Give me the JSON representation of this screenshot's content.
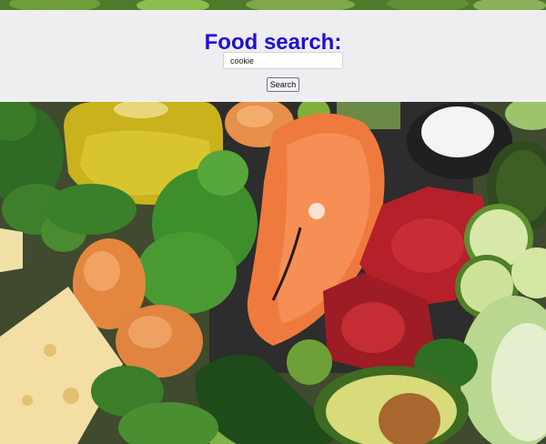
{
  "page": {
    "title": "Food search:",
    "title_color": "#1d10d6"
  },
  "search": {
    "value": "cookie",
    "button_label": "Search"
  }
}
